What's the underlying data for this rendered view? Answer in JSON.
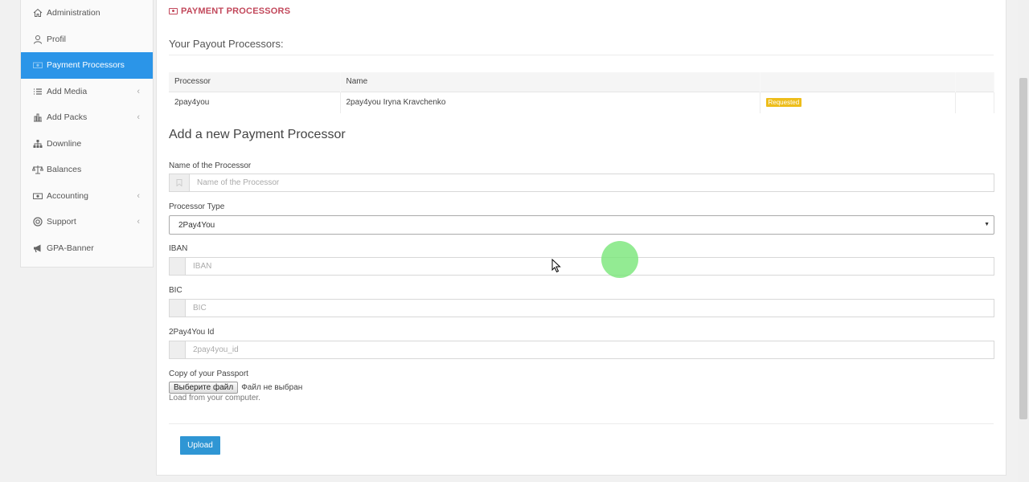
{
  "sidebar": {
    "items": [
      {
        "label": "Administration",
        "icon": "home-icon",
        "active": false,
        "has_submenu": false
      },
      {
        "label": "Profil",
        "icon": "user-icon",
        "active": false,
        "has_submenu": false
      },
      {
        "label": "Payment Processors",
        "icon": "money-icon",
        "active": true,
        "has_submenu": false
      },
      {
        "label": "Add Media",
        "icon": "list-icon",
        "active": false,
        "has_submenu": true
      },
      {
        "label": "Add Packs",
        "icon": "bar-chart-icon",
        "active": false,
        "has_submenu": true
      },
      {
        "label": "Downline",
        "icon": "sitemap-icon",
        "active": false,
        "has_submenu": false
      },
      {
        "label": "Balances",
        "icon": "scale-icon",
        "active": false,
        "has_submenu": false
      },
      {
        "label": "Accounting",
        "icon": "money-icon",
        "active": false,
        "has_submenu": true
      },
      {
        "label": "Support",
        "icon": "lifebuoy-icon",
        "active": false,
        "has_submenu": true
      },
      {
        "label": "GPA-Banner",
        "icon": "megaphone-icon",
        "active": false,
        "has_submenu": false
      }
    ],
    "submenu_arrow": "‹"
  },
  "main": {
    "section_title": "PAYMENT PROCESSORS",
    "payout_heading": "Your Payout Processors:",
    "table": {
      "headers": [
        "Processor",
        "Name"
      ],
      "rows": [
        {
          "processor": "2pay4you",
          "name": "2pay4you Iryna Kravchenko",
          "status": "Requested"
        }
      ]
    },
    "form_title": "Add a new Payment Processor",
    "fields": {
      "processor_name": {
        "label": "Name of the Processor",
        "placeholder": "Name of the Processor",
        "value": ""
      },
      "processor_type": {
        "label": "Processor Type",
        "value": "2Pay4You"
      },
      "iban": {
        "label": "IBAN",
        "placeholder": "IBAN",
        "value": ""
      },
      "bic": {
        "label": "BIC",
        "placeholder": "BIC",
        "value": ""
      },
      "pay_id": {
        "label": "2Pay4You Id",
        "placeholder": "2pay4you_id",
        "value": ""
      },
      "passport": {
        "label": "Copy of your Passport",
        "button": "Выберите файл",
        "status": "Файл не выбран",
        "help": "Load from your computer."
      }
    },
    "upload_label": "Upload"
  },
  "colors": {
    "accent": "#2b95e8",
    "title": "#c2485b",
    "badge": "#edbd1a",
    "button": "#2f96d4"
  }
}
